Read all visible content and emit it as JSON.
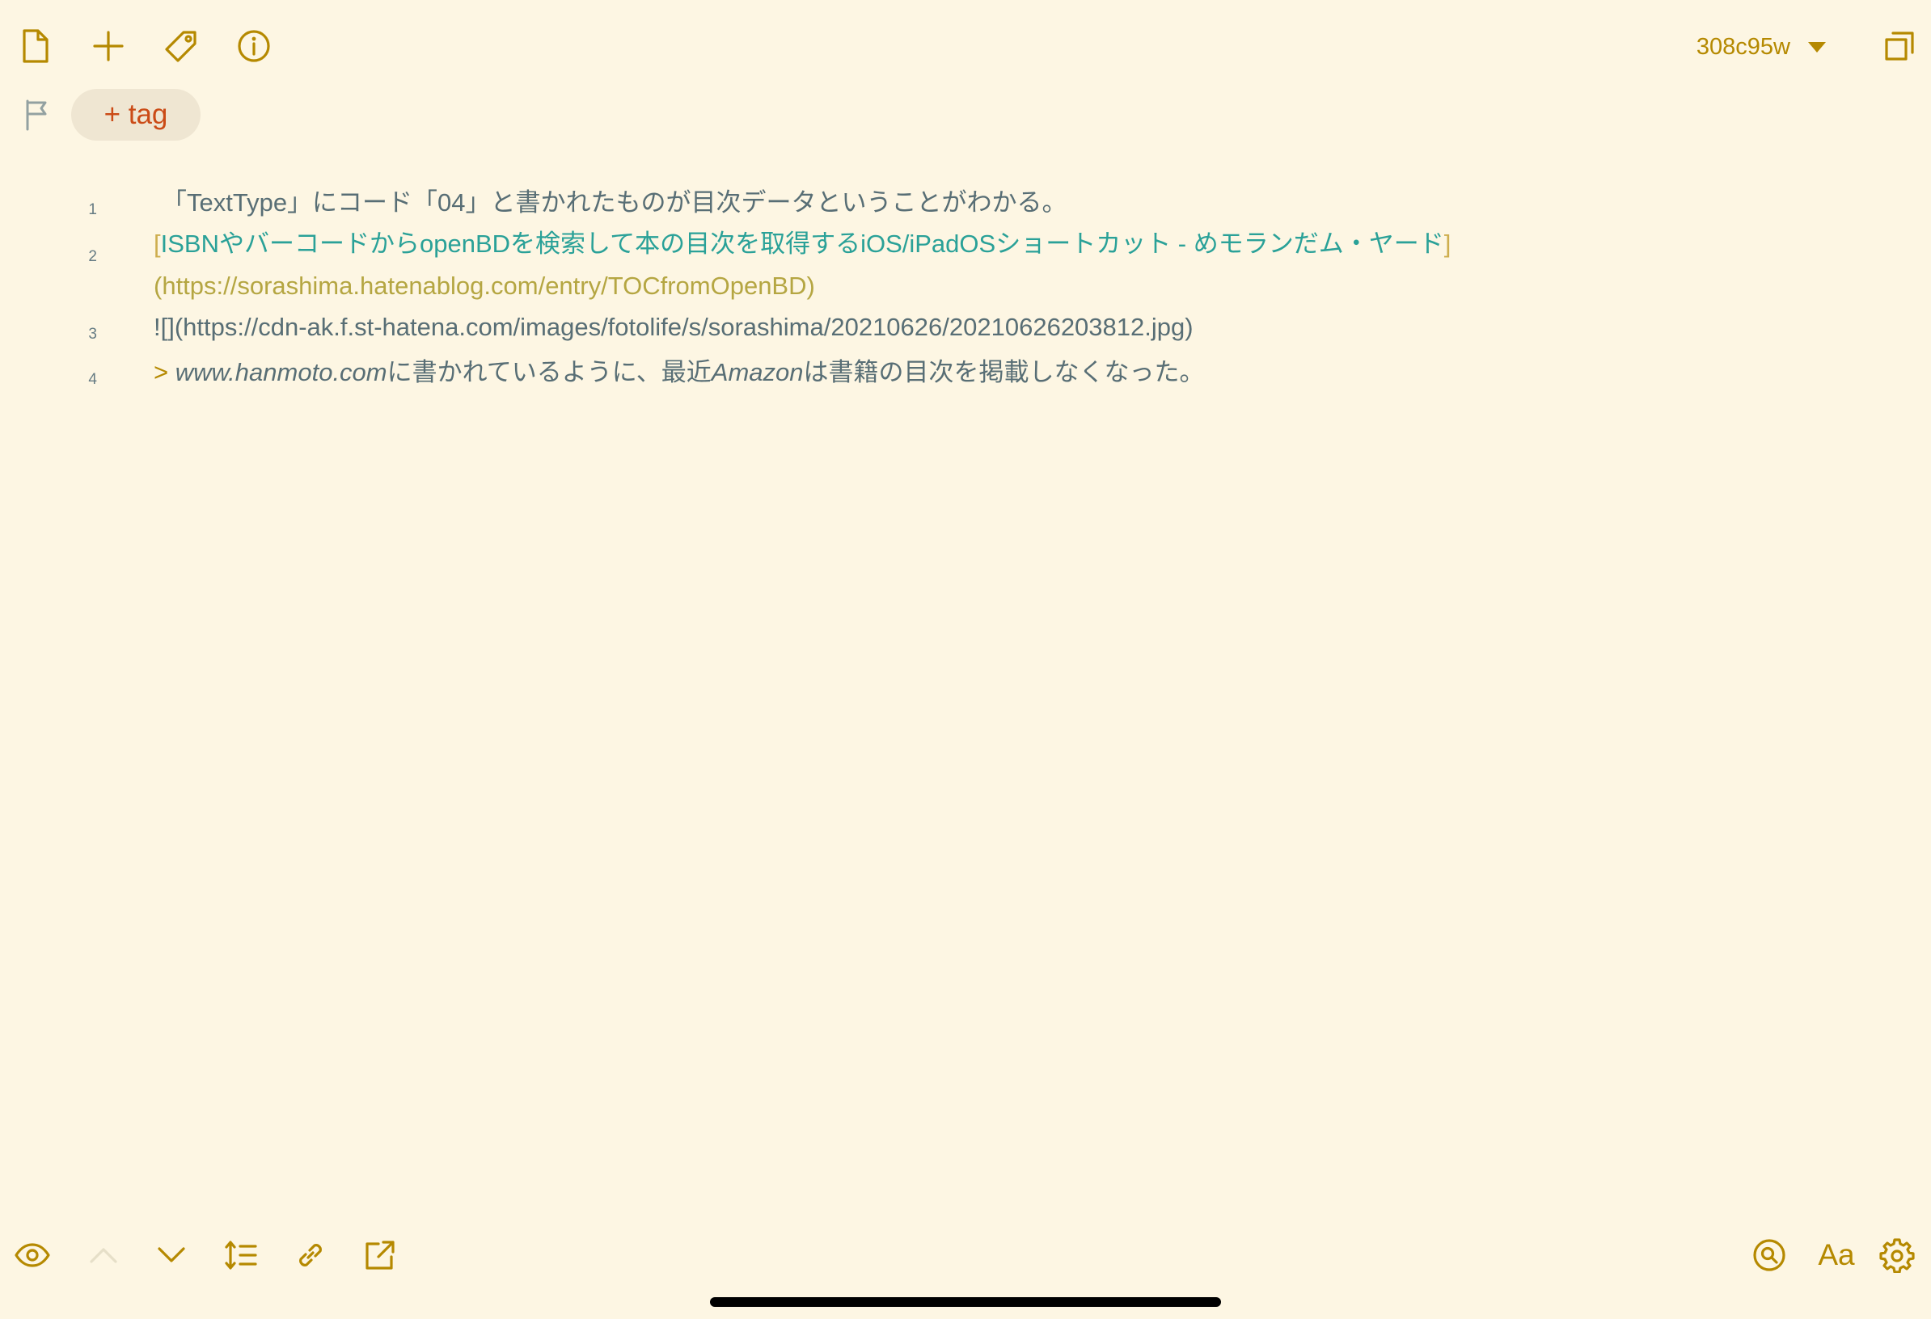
{
  "toolbar_top": {
    "icons": [
      "document-icon",
      "plus-icon",
      "tag-icon",
      "info-icon"
    ],
    "version_label": "308c95w",
    "expand_icon": "expand-icon"
  },
  "tags": {
    "flag_icon": "flag-icon",
    "add_tag_label": "+ tag"
  },
  "editor": {
    "lines": [
      {
        "number": "1",
        "text": "「TextType」にコード「04」と書かれたものが目次データということがわかる。"
      },
      {
        "number": "2",
        "open_bracket": "[",
        "link_text": "ISBNやバーコードからopenBDを検索して本の目次を取得するiOS/iPadOSショートカット - めモランだム・ヤード",
        "close_bracket": "]",
        "link_url": "(https://sorashima.hatenablog.com/entry/TOCfromOpenBD)"
      },
      {
        "number": "3",
        "text": "![](https://cdn-ak.f.st-hatena.com/images/fotolife/s/sorashima/20210626/20210626203812.jpg)"
      },
      {
        "number": "4",
        "quote_mark": ">",
        "part1": "www.hanmoto.com",
        "part2": "に書かれているように、最近",
        "part3": "Amazon",
        "part4": "は書籍の目次を掲載しなくなった。"
      }
    ]
  },
  "toolbar_bottom": {
    "left_icons": [
      "eye-icon",
      "chevron-up-icon",
      "chevron-down-icon",
      "line-spacing-icon",
      "link-icon",
      "share-icon"
    ],
    "right_icons": [
      "search-icon",
      "font-size-icon",
      "gear-icon"
    ],
    "font_label": "Aa"
  },
  "colors": {
    "background": "#fdf6e3",
    "accent": "#b58900",
    "tag": "#cb4b16",
    "link": "#2aa198",
    "text": "#586e75"
  }
}
